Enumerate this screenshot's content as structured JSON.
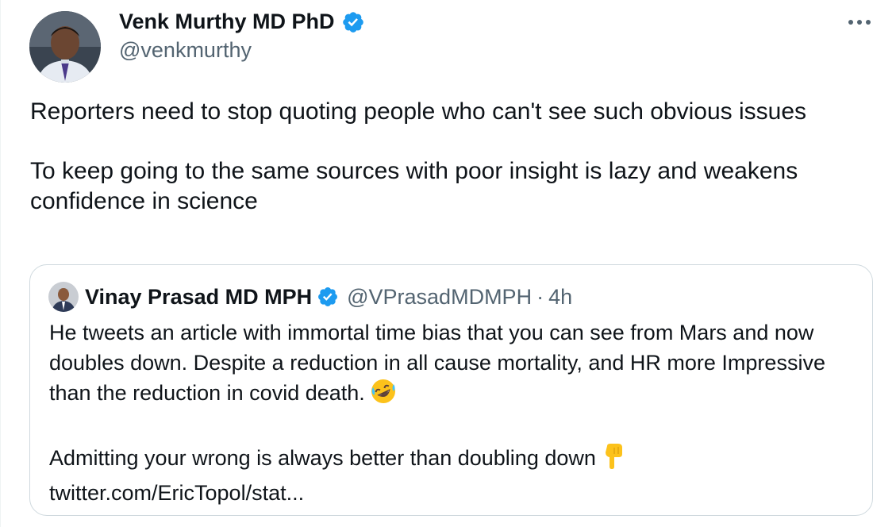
{
  "author": {
    "name": "Venk Murthy MD PhD",
    "handle": "@venkmurthy",
    "verified_color": "#1d9bf0"
  },
  "tweet": {
    "paragraph_1": "Reporters need to stop quoting people who can't see such obvious issues",
    "paragraph_2": "To keep going to the same sources with poor insight is lazy and weakens confidence in science"
  },
  "quote": {
    "name": "Vinay Prasad MD MPH",
    "handle": "@VPrasadMDMPH",
    "separator": "·",
    "time": "4h",
    "paragraph_1": "He tweets an article with immortal time bias that you can see from Mars and now doubles down. Despite a reduction in all cause mortality, and HR more Impressive than the reduction in covid death.",
    "paragraph_1_emoji": "rolling-on-floor-laughing-emoji",
    "paragraph_2": "Admitting your wrong is always better than doubling down",
    "paragraph_2_emoji": "backhand-index-pointing-down-emoji",
    "link": "twitter.com/EricTopol/stat..."
  },
  "icons": {
    "more": "more-icon",
    "verified": "verified-badge-icon"
  }
}
